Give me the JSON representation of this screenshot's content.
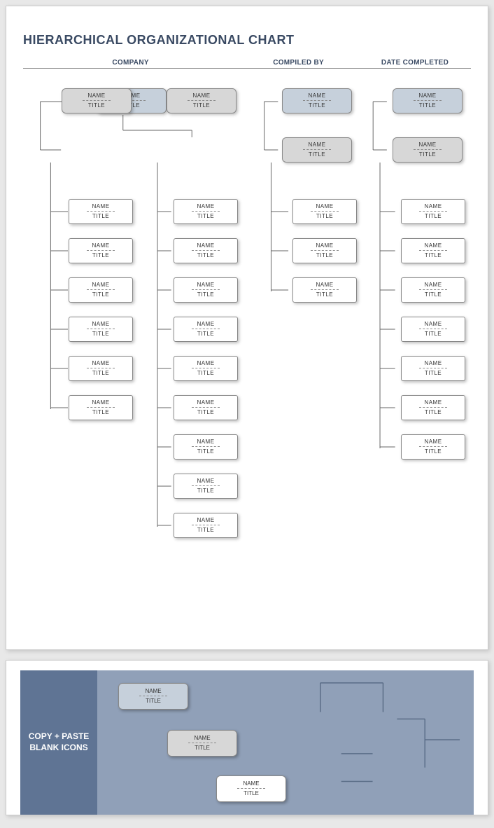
{
  "title": "HIERARCHICAL ORGANIZATIONAL CHART",
  "headers": {
    "company": "COMPANY",
    "compiled_by": "COMPILED BY",
    "date_completed": "DATE COMPLETED"
  },
  "labels": {
    "name": "NAME",
    "title": "TITLE"
  },
  "branch1": {
    "top": {
      "name": "NAME",
      "title": "TITLE"
    },
    "midA": {
      "name": "NAME",
      "title": "TITLE"
    },
    "midB": {
      "name": "NAME",
      "title": "TITLE"
    },
    "colA": [
      {
        "name": "NAME",
        "title": "TITLE"
      },
      {
        "name": "NAME",
        "title": "TITLE"
      },
      {
        "name": "NAME",
        "title": "TITLE"
      },
      {
        "name": "NAME",
        "title": "TITLE"
      },
      {
        "name": "NAME",
        "title": "TITLE"
      },
      {
        "name": "NAME",
        "title": "TITLE"
      }
    ],
    "colB": [
      {
        "name": "NAME",
        "title": "TITLE"
      },
      {
        "name": "NAME",
        "title": "TITLE"
      },
      {
        "name": "NAME",
        "title": "TITLE"
      },
      {
        "name": "NAME",
        "title": "TITLE"
      },
      {
        "name": "NAME",
        "title": "TITLE"
      },
      {
        "name": "NAME",
        "title": "TITLE"
      },
      {
        "name": "NAME",
        "title": "TITLE"
      },
      {
        "name": "NAME",
        "title": "TITLE"
      },
      {
        "name": "NAME",
        "title": "TITLE"
      }
    ]
  },
  "branch2": {
    "top": {
      "name": "NAME",
      "title": "TITLE"
    },
    "mid": {
      "name": "NAME",
      "title": "TITLE"
    },
    "col": [
      {
        "name": "NAME",
        "title": "TITLE"
      },
      {
        "name": "NAME",
        "title": "TITLE"
      },
      {
        "name": "NAME",
        "title": "TITLE"
      }
    ]
  },
  "branch3": {
    "top": {
      "name": "NAME",
      "title": "TITLE"
    },
    "mid": {
      "name": "NAME",
      "title": "TITLE"
    },
    "col": [
      {
        "name": "NAME",
        "title": "TITLE"
      },
      {
        "name": "NAME",
        "title": "TITLE"
      },
      {
        "name": "NAME",
        "title": "TITLE"
      },
      {
        "name": "NAME",
        "title": "TITLE"
      },
      {
        "name": "NAME",
        "title": "TITLE"
      },
      {
        "name": "NAME",
        "title": "TITLE"
      },
      {
        "name": "NAME",
        "title": "TITLE"
      }
    ]
  },
  "copy_panel": {
    "label": "COPY + PASTE BLANK ICONS",
    "samples": [
      {
        "name": "NAME",
        "title": "TITLE"
      },
      {
        "name": "NAME",
        "title": "TITLE"
      },
      {
        "name": "NAME",
        "title": "TITLE"
      }
    ]
  }
}
